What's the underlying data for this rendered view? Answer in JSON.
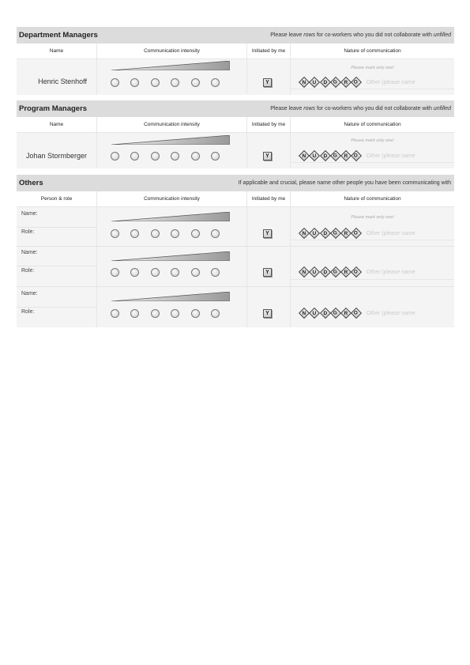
{
  "common": {
    "col_name": "Name",
    "col_intensity": "Communication intensity",
    "col_initiated": "Initiated by me",
    "col_nature": "Nature of communication",
    "mark_hint": "Please mark only one!",
    "y_label": "Y",
    "nature_codes": [
      "N",
      "U",
      "D",
      "G",
      "R",
      "O"
    ],
    "other_placeholder": "Other (please name"
  },
  "dept": {
    "title": "Department Managers",
    "note_pre": "Please leave ",
    "note_em1": "rows",
    "note_mid": " for co-workers who you did not collaborate with ",
    "note_em2": "unfilled",
    "person": "Henric Stenhoff"
  },
  "prog": {
    "title": "Program Managers",
    "note_pre": "Please leave ",
    "note_em1": "rows",
    "note_mid": " for co-workers who you did not collaborate with ",
    "note_em2": "unfilled",
    "person": "Johan Stormberger"
  },
  "others": {
    "title": "Others",
    "note": "If applicable and crucial, please name other people you have been communicating with",
    "col_person": "Person & role",
    "name_label": "Name:",
    "role_label": "Role:"
  }
}
